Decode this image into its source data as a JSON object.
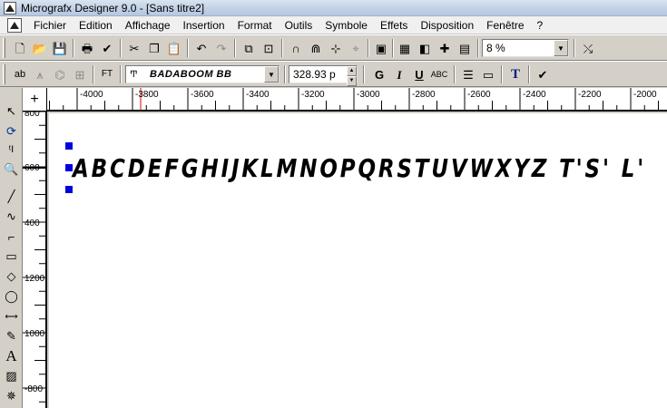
{
  "window": {
    "title": "Micrografx Designer 9.0 - [Sans titre2]"
  },
  "menu": [
    "Fichier",
    "Edition",
    "Affichage",
    "Insertion",
    "Format",
    "Outils",
    "Symbole",
    "Effets",
    "Disposition",
    "Fenêtre",
    "?"
  ],
  "toolbar1": {
    "zoom_value": "8 %"
  },
  "toolbar2": {
    "font_name": "BADABOOM BB",
    "font_size": "328.93 p",
    "bold_label": "G",
    "italic_label": "I",
    "underline_label": "U",
    "smallcaps_label": "ABC",
    "text_tool_label": "T"
  },
  "ruler_h": {
    "labels": [
      "-4000",
      "-3800",
      "-3600",
      "-3400",
      "-3200",
      "-3000",
      "-2800",
      "-2600",
      "-2400",
      "-2200",
      "-2000"
    ]
  },
  "ruler_v": {
    "labels": [
      "800",
      "600",
      "400",
      "1200",
      "1000",
      "-800"
    ]
  },
  "canvas": {
    "text": "ABCDEFGHIJKLMNOPQRSTUVWXYZ T'S' L'"
  },
  "toolbox": {
    "text_tool_label": "A"
  }
}
